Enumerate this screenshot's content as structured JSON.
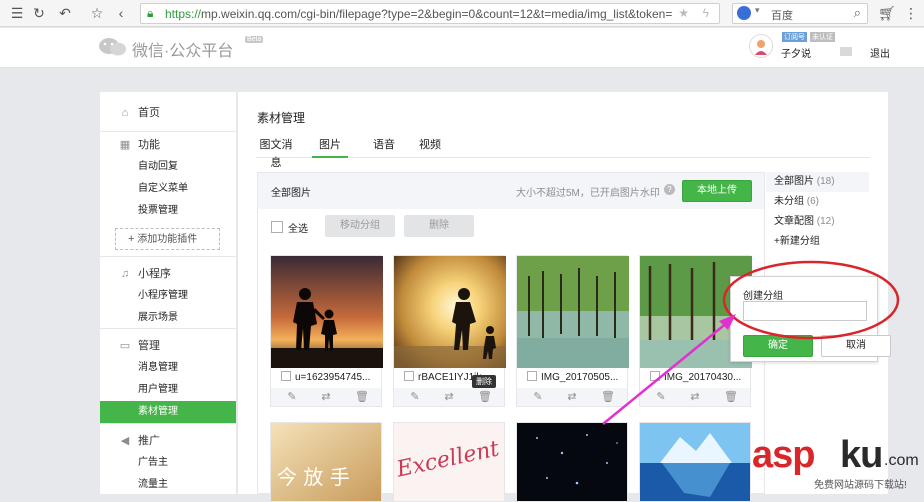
{
  "browser": {
    "url_scheme": "https://",
    "url_host": "mp.weixin.qq.com",
    "url_rest": "/cgi-bin/filepage?type=2&begin=0&count=12&t=media/img_list&token=",
    "search_engine": "百度"
  },
  "header": {
    "logo_text": "微信·公众平台",
    "beta": "Beta",
    "account_badge1": "订阅号",
    "account_badge2": "未认证",
    "account_name": "子夕说",
    "logout": "退出"
  },
  "sidebar": {
    "home": "首页",
    "groups": [
      {
        "title": "功能",
        "icon": "grid-icon",
        "items": [
          "自动回复",
          "自定义菜单",
          "投票管理"
        ]
      },
      {
        "title": "小程序",
        "icon": "miniprogram-icon",
        "items": [
          "小程序管理",
          "展示场景"
        ]
      },
      {
        "title": "管理",
        "icon": "inbox-icon",
        "items": [
          "消息管理",
          "用户管理",
          "素材管理"
        ]
      },
      {
        "title": "推广",
        "icon": "megaphone-icon",
        "items": [
          "广告主",
          "流量主"
        ]
      }
    ],
    "add_plugin": "添加功能插件"
  },
  "main": {
    "title": "素材管理",
    "tabs": [
      "图文消息",
      "图片",
      "语音",
      "视频"
    ],
    "active_tab": "图片",
    "panel_title": "全部图片",
    "upload_hint": "大小不超过5M，已开启图片水印",
    "upload_button": "本地上传",
    "select_all": "全选",
    "move_group": "移动分组",
    "delete": "删除"
  },
  "groups": [
    {
      "name": "全部图片",
      "count": "(18)"
    },
    {
      "name": "未分组",
      "count": "(6)"
    },
    {
      "name": "文章配图",
      "count": "(12)"
    }
  ],
  "new_group": "新建分组",
  "images": [
    {
      "name": "u=1623954745..."
    },
    {
      "name": "rBACE1IYJ1jk..."
    },
    {
      "name": "IMG_20170505..."
    },
    {
      "name": "IMG_20170430..."
    }
  ],
  "tooltip_delete": "删除",
  "images_row2_text": [
    "今 放 手",
    "Excellent"
  ],
  "popover": {
    "label": "创建分组",
    "input_value": "",
    "confirm": "确定",
    "cancel": "取消"
  },
  "watermark": {
    "brand_a": "asp",
    "brand_b": "ku",
    "brand_c": ".com",
    "tagline": "免费网站源码下载站!"
  },
  "colors": {
    "accent": "#44b549",
    "annotation": "#d9262b",
    "arrow": "#e32fd0"
  }
}
